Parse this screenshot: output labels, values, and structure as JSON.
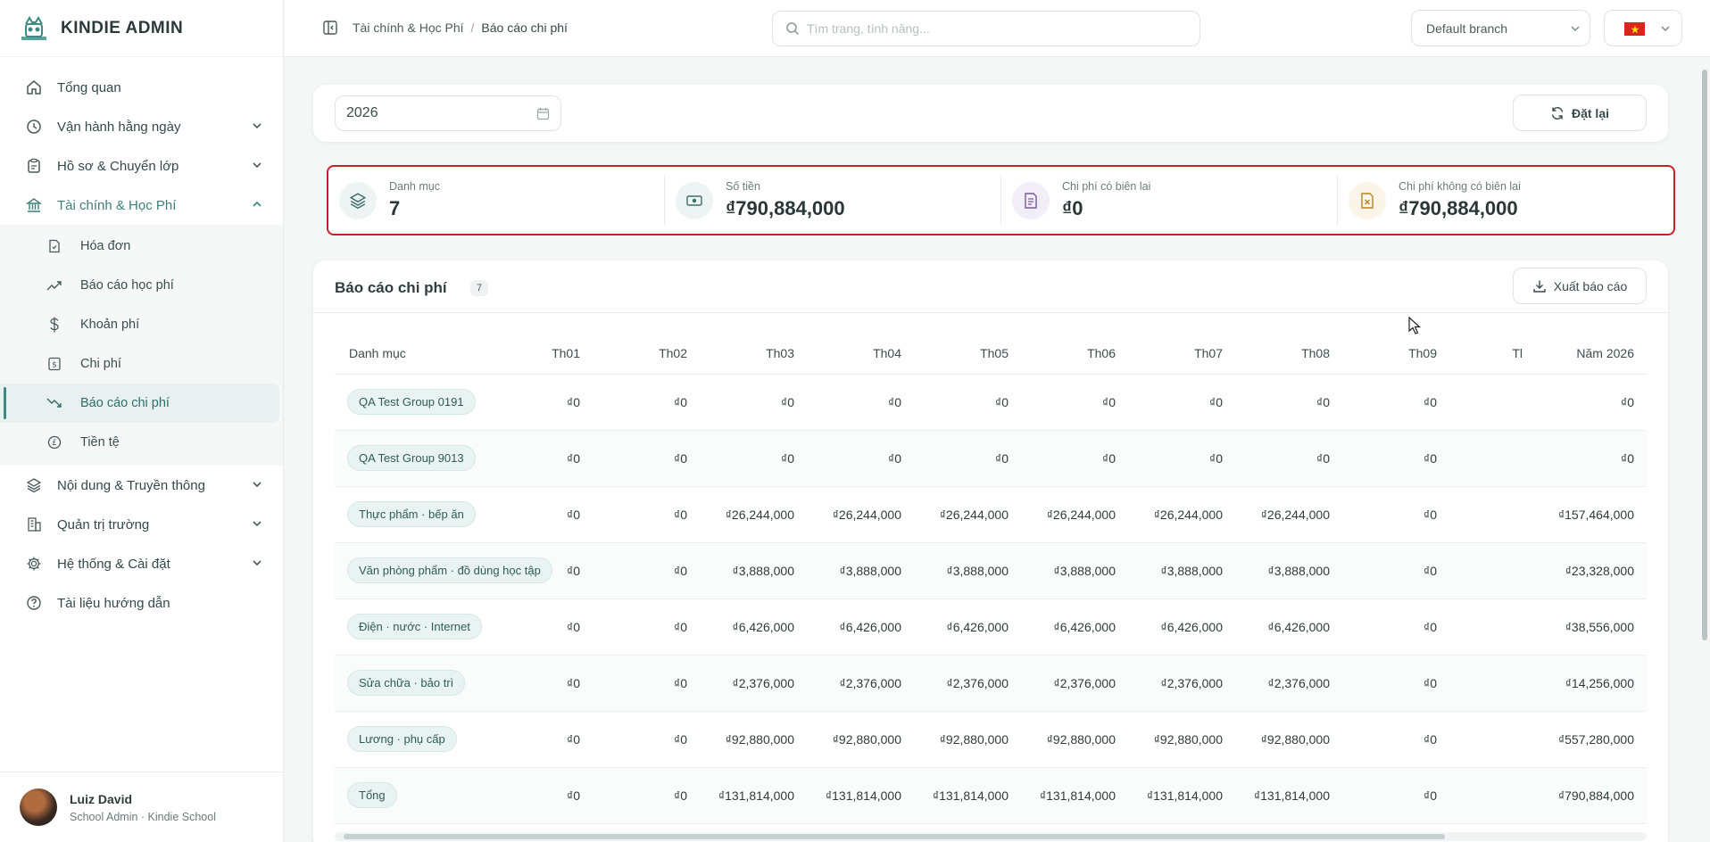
{
  "app": {
    "brand": "KINDIE ADMIN"
  },
  "sidebar": {
    "items": [
      {
        "label": "Tổng quan",
        "icon": "home-icon"
      },
      {
        "label": "Vận hành hằng ngày",
        "icon": "clock-icon"
      },
      {
        "label": "Hồ sơ & Chuyển lớp",
        "icon": "clipboard-icon"
      },
      {
        "label": "Tài chính & Học Phí",
        "icon": "bank-icon"
      },
      {
        "label": "Nội dung & Truyền thông",
        "icon": "layers-icon"
      },
      {
        "label": "Quản trị trường",
        "icon": "building-icon"
      },
      {
        "label": "Hệ thống & Cài đặt",
        "icon": "gear-icon"
      },
      {
        "label": "Tài liệu hướng dẫn",
        "icon": "help-icon"
      }
    ],
    "finance_sub": [
      {
        "label": "Hóa đơn",
        "icon": "invoice-icon"
      },
      {
        "label": "Báo cáo học phí",
        "icon": "trend-up-icon"
      },
      {
        "label": "Khoản phí",
        "icon": "dollar-icon"
      },
      {
        "label": "Chi phí",
        "icon": "receipt-icon"
      },
      {
        "label": "Báo cáo chi phí",
        "icon": "trend-down-icon"
      },
      {
        "label": "Tiền tệ",
        "icon": "currency-icon"
      }
    ],
    "user": {
      "name": "Luiz David",
      "role": "School Admin · Kindie School"
    }
  },
  "topbar": {
    "breadcrumb": [
      "Tài chính & Học Phí",
      "Báo cáo chi phí"
    ],
    "search_placeholder": "Tìm trang, tính năng...",
    "branch": "Default branch"
  },
  "filters": {
    "year": "2026",
    "reset_label": "Đặt lại"
  },
  "stats": [
    {
      "label": "Danh mục",
      "value": "7",
      "icon": "layers-icon",
      "color": "#eef3f3"
    },
    {
      "label": "Số tiền",
      "value": "₫790,884,000",
      "icon": "banknote-icon",
      "color": "#eef3f3"
    },
    {
      "label": "Chi phí có biên lai",
      "value": "₫0",
      "icon": "document-icon",
      "color": "#f2eef7"
    },
    {
      "label": "Chi phí không có biên lai",
      "value": "₫790,884,000",
      "icon": "file-x-icon",
      "color": "#fbf4e8"
    }
  ],
  "report": {
    "title": "Báo cáo chi phí",
    "count": "7",
    "export_label": "Xuất báo cáo",
    "columns": [
      "Danh mục",
      "Th01",
      "Th02",
      "Th03",
      "Th04",
      "Th05",
      "Th06",
      "Th07",
      "Th08",
      "Th09",
      "Tl",
      "Năm 2026"
    ],
    "rows": [
      {
        "category": "QA Test Group 0191",
        "values": [
          "₫0",
          "₫0",
          "₫0",
          "₫0",
          "₫0",
          "₫0",
          "₫0",
          "₫0",
          "₫0",
          "",
          "₫0"
        ]
      },
      {
        "category": "QA Test Group 9013",
        "values": [
          "₫0",
          "₫0",
          "₫0",
          "₫0",
          "₫0",
          "₫0",
          "₫0",
          "₫0",
          "₫0",
          "",
          "₫0"
        ]
      },
      {
        "category": "Thực phẩm · bếp ăn",
        "values": [
          "₫0",
          "₫0",
          "₫26,244,000",
          "₫26,244,000",
          "₫26,244,000",
          "₫26,244,000",
          "₫26,244,000",
          "₫26,244,000",
          "₫0",
          "",
          "₫157,464,000"
        ]
      },
      {
        "category": "Văn phòng phẩm · đồ dùng học tập",
        "values": [
          "₫0",
          "₫0",
          "₫3,888,000",
          "₫3,888,000",
          "₫3,888,000",
          "₫3,888,000",
          "₫3,888,000",
          "₫3,888,000",
          "₫0",
          "",
          "₫23,328,000"
        ]
      },
      {
        "category": "Điện · nước · Internet",
        "values": [
          "₫0",
          "₫0",
          "₫6,426,000",
          "₫6,426,000",
          "₫6,426,000",
          "₫6,426,000",
          "₫6,426,000",
          "₫6,426,000",
          "₫0",
          "",
          "₫38,556,000"
        ]
      },
      {
        "category": "Sửa chữa · bảo trì",
        "values": [
          "₫0",
          "₫0",
          "₫2,376,000",
          "₫2,376,000",
          "₫2,376,000",
          "₫2,376,000",
          "₫2,376,000",
          "₫2,376,000",
          "₫0",
          "",
          "₫14,256,000"
        ]
      },
      {
        "category": "Lương · phụ cấp",
        "values": [
          "₫0",
          "₫0",
          "₫92,880,000",
          "₫92,880,000",
          "₫92,880,000",
          "₫92,880,000",
          "₫92,880,000",
          "₫92,880,000",
          "₫0",
          "",
          "₫557,280,000"
        ]
      },
      {
        "category": "Tổng",
        "values": [
          "₫0",
          "₫0",
          "₫131,814,000",
          "₫131,814,000",
          "₫131,814,000",
          "₫131,814,000",
          "₫131,814,000",
          "₫131,814,000",
          "₫0",
          "",
          "₫790,884,000"
        ]
      }
    ]
  },
  "colors": {
    "accent": "#3d8a82",
    "highlight_border": "#c6202a"
  }
}
